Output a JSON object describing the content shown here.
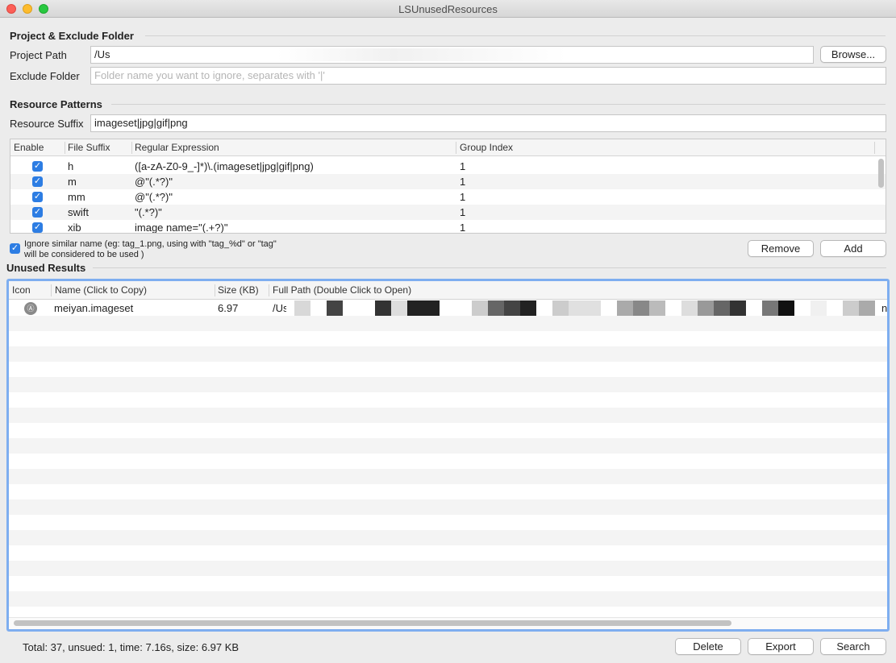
{
  "window": {
    "title": "LSUnusedResources"
  },
  "project_section": {
    "title": "Project & Exclude Folder",
    "project_path_label": "Project Path",
    "project_path_value": "/Us",
    "browse_label": "Browse...",
    "exclude_label": "Exclude Folder",
    "exclude_placeholder": "Folder name you want to ignore, separates with '|'"
  },
  "patterns_section": {
    "title": "Resource Patterns",
    "suffix_label": "Resource Suffix",
    "suffix_value": "imageset|jpg|gif|png",
    "columns": [
      "Enable",
      "File Suffix",
      "Regular Expression",
      "Group Index"
    ],
    "rows": [
      {
        "enabled": true,
        "suffix": "h",
        "regex": "([a-zA-Z0-9_-]*)\\.(imageset|jpg|gif|png)",
        "group": "1"
      },
      {
        "enabled": true,
        "suffix": "m",
        "regex": "@\"(.*?)\"",
        "group": "1"
      },
      {
        "enabled": true,
        "suffix": "mm",
        "regex": "@\"(.*?)\"",
        "group": "1"
      },
      {
        "enabled": true,
        "suffix": "swift",
        "regex": "\"(.*?)\"",
        "group": "1"
      },
      {
        "enabled": true,
        "suffix": "xib",
        "regex": "image name=\"(.+?)\"",
        "group": "1"
      }
    ],
    "ignore_similar_line1": "Ignore similar name (eg: tag_1.png, using with \"tag_%d\" or \"tag\"",
    "ignore_similar_line2": "will be considered to be used )",
    "remove_label": "Remove",
    "add_label": "Add"
  },
  "results_section": {
    "title": "Unused Results",
    "columns": [
      "Icon",
      "Name (Click to Copy)",
      "Size (KB)",
      "Full Path (Double Click to Open)"
    ],
    "rows": [
      {
        "name": "meiyan.imageset",
        "size": "6.97",
        "path_start": "/Us",
        "path_end": "n"
      }
    ]
  },
  "status": {
    "text": "Total: 37, unsued: 1, time: 7.16s, size: 6.97 KB"
  },
  "bottom_buttons": {
    "delete_label": "Delete",
    "export_label": "Export",
    "search_label": "Search"
  },
  "colors": {
    "accent": "#2d7de3",
    "focus_ring": "#7eaef0"
  }
}
